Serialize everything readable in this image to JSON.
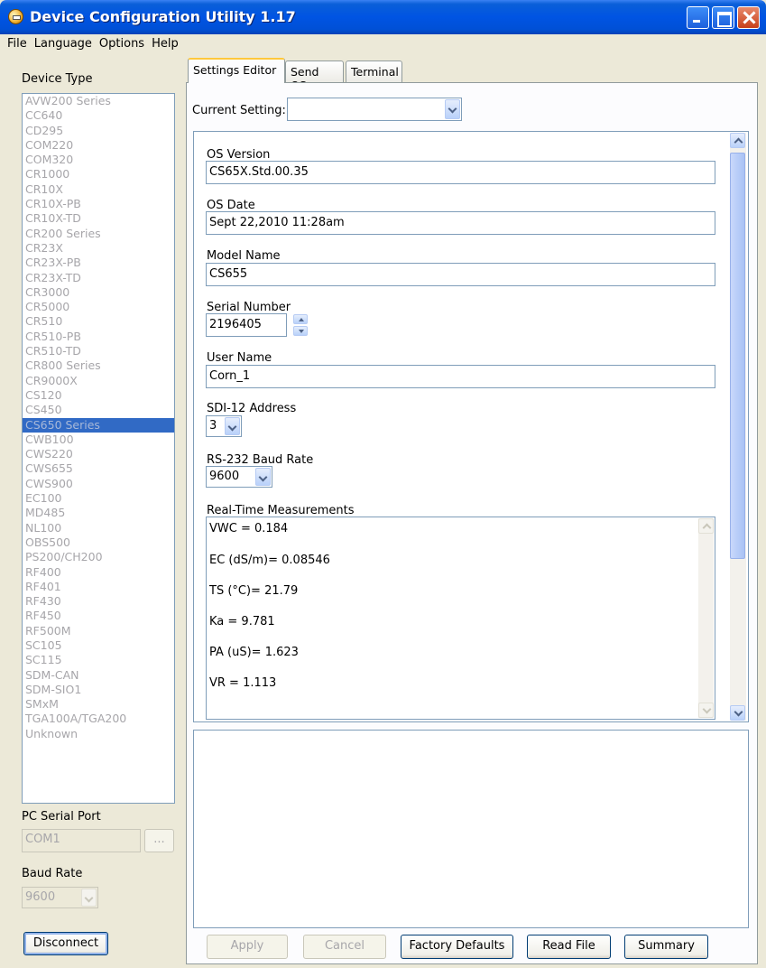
{
  "window": {
    "title": "Device Configuration Utility 1.17"
  },
  "menu": [
    {
      "label": "File"
    },
    {
      "label": "Language"
    },
    {
      "label": "Options"
    },
    {
      "label": "Help"
    }
  ],
  "left": {
    "device_type_label": "Device Type",
    "devices": [
      "AVW200 Series",
      "CC640",
      "CD295",
      "COM220",
      "COM320",
      "CR1000",
      "CR10X",
      "CR10X-PB",
      "CR10X-TD",
      "CR200 Series",
      "CR23X",
      "CR23X-PB",
      "CR23X-TD",
      "CR3000",
      "CR5000",
      "CR510",
      "CR510-PB",
      "CR510-TD",
      "CR800 Series",
      "CR9000X",
      "CS120",
      "CS450",
      "CS650 Series",
      "CWB100",
      "CWS220",
      "CWS655",
      "CWS900",
      "EC100",
      "MD485",
      "NL100",
      "OBS500",
      "PS200/CH200",
      "RF400",
      "RF401",
      "RF430",
      "RF450",
      "RF500M",
      "SC105",
      "SC115",
      "SDM-CAN",
      "SDM-SIO1",
      "SMxM",
      "TGA100A/TGA200",
      "Unknown"
    ],
    "selected_device": "CS650 Series",
    "serial_port_label": "PC Serial Port",
    "serial_port_value": "COM1",
    "browse_label": "...",
    "baud_label": "Baud Rate",
    "baud_value": "9600",
    "disconnect_label": "Disconnect"
  },
  "tabs": [
    {
      "label": "Settings Editor",
      "active": true
    },
    {
      "label": "Send OS",
      "active": false
    },
    {
      "label": "Terminal",
      "active": false
    }
  ],
  "settings": {
    "current_setting_label": "Current Setting:",
    "current_setting_value": "",
    "os_version_label": "OS Version",
    "os_version_value": "CS65X.Std.00.35",
    "os_date_label": "OS Date",
    "os_date_value": "Sept 22,2010 11:28am",
    "model_name_label": "Model Name",
    "model_name_value": "CS655",
    "serial_number_label": "Serial Number",
    "serial_number_value": "2196405",
    "user_name_label": "User Name",
    "user_name_value": "Corn_1",
    "sdi_label": "SDI-12 Address",
    "sdi_value": "3",
    "rs232_label": "RS-232 Baud Rate",
    "rs232_value": "9600",
    "realtime_label": "Real-Time Measurements",
    "realtime_lines": [
      "VWC = 0.184",
      "EC (dS/m)= 0.08546",
      "TS (°C)= 21.79",
      "Ka = 9.781",
      "PA (uS)= 1.623",
      "VR = 1.113"
    ]
  },
  "buttons": {
    "apply": "Apply",
    "cancel": "Cancel",
    "factory_defaults": "Factory Defaults",
    "read_file": "Read File",
    "summary": "Summary"
  },
  "colors": {
    "selection": "#316ac5",
    "titlebar": "#0054e3",
    "tab_highlight": "#ffc83c"
  }
}
